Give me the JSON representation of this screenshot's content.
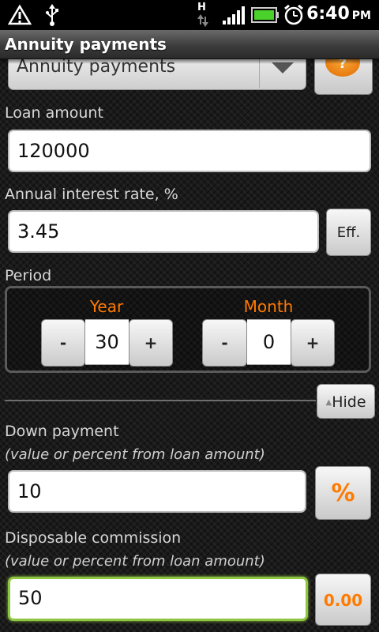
{
  "status_bar": {
    "time": "6:40",
    "ampm": "PM",
    "network_type": "H",
    "icons": [
      "warning-icon",
      "usb-icon",
      "network-h-icon",
      "signal-icon",
      "battery-icon",
      "alarm-icon"
    ]
  },
  "title_bar": {
    "title": "Annuity payments"
  },
  "calc_type": {
    "selected": "Annuity payments"
  },
  "help_button": {
    "icon": "help-icon",
    "glyph": "?"
  },
  "loan_amount": {
    "label": "Loan amount",
    "value": "120000"
  },
  "interest_rate": {
    "label": "Annual interest rate, %",
    "value": "3.45",
    "eff_label": "Eff."
  },
  "period": {
    "label": "Period",
    "year": {
      "label": "Year",
      "value": "30",
      "minus": "-",
      "plus": "+"
    },
    "month": {
      "label": "Month",
      "value": "0",
      "minus": "-",
      "plus": "+"
    }
  },
  "hide_button": {
    "label": "Hide"
  },
  "down_payment": {
    "label": "Down payment",
    "hint": "(value or percent from loan amount)",
    "value": "10",
    "mode_label": "%"
  },
  "commission": {
    "label": "Disposable commission",
    "hint": "(value or percent from loan amount)",
    "value": "50",
    "mode_label": "0.00"
  },
  "colors": {
    "accent": "#ff7a00",
    "focus": "#8fc641"
  }
}
